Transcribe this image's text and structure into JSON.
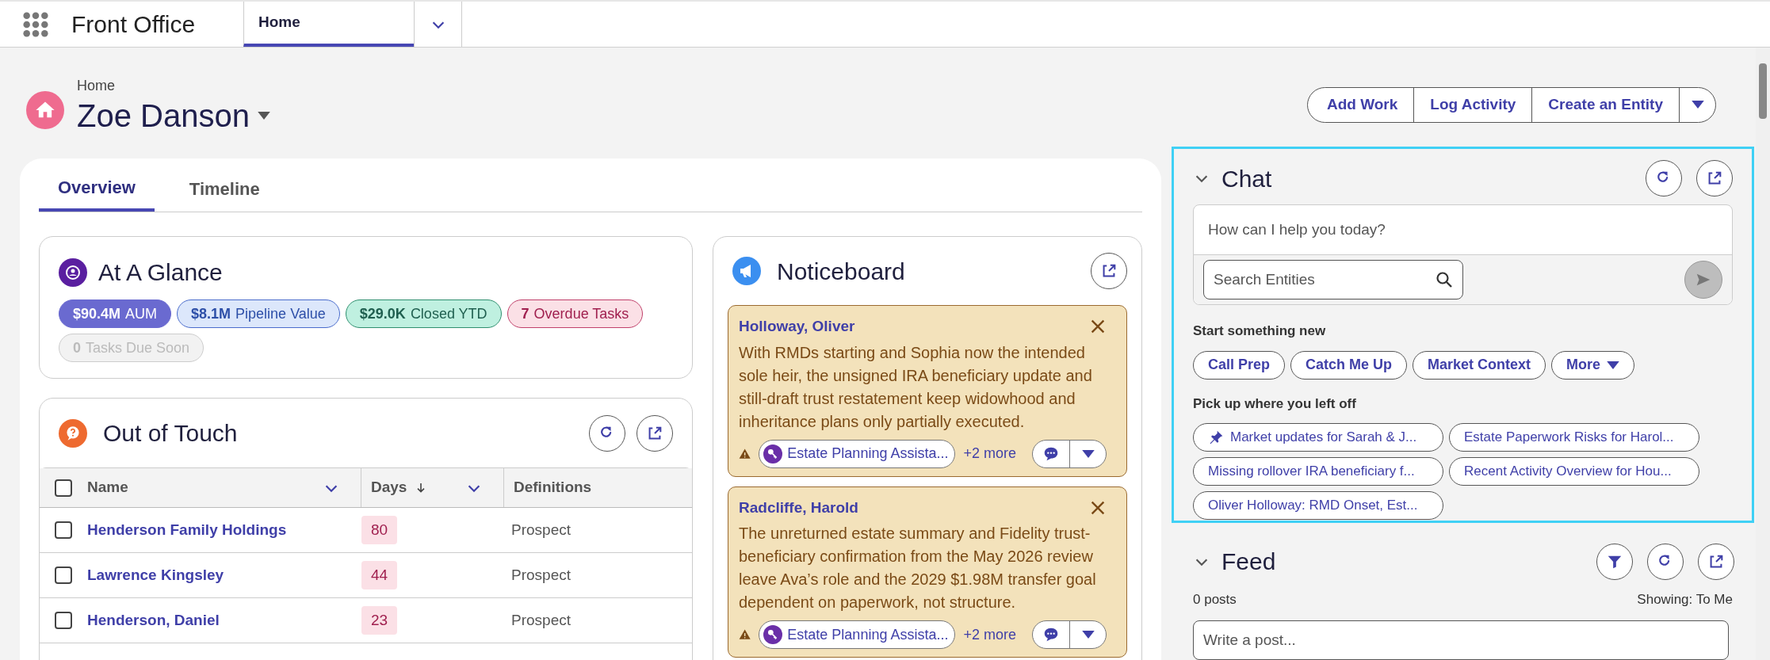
{
  "app": {
    "name": "Front Office"
  },
  "nav_tabs": [
    {
      "label": "Home",
      "selected": true
    }
  ],
  "page": {
    "breadcrumb": "Home",
    "title": "Zoe Danson"
  },
  "actions": [
    "Add Work",
    "Log Activity",
    "Create an Entity"
  ],
  "main_tabs": [
    {
      "label": "Overview",
      "selected": true
    },
    {
      "label": "Timeline",
      "selected": false
    }
  ],
  "at_a_glance": {
    "title": "At A Glance",
    "metrics": [
      {
        "kind": "aum",
        "value": "$90.4M",
        "label": "AUM"
      },
      {
        "kind": "pipeline",
        "value": "$8.1M",
        "label": "Pipeline Value"
      },
      {
        "kind": "closed",
        "value": "$29.0K",
        "label": "Closed YTD"
      },
      {
        "kind": "overdue",
        "value": "7",
        "label": "Overdue Tasks"
      },
      {
        "kind": "due",
        "value": "0",
        "label": "Tasks Due Soon"
      }
    ]
  },
  "out_of_touch": {
    "title": "Out of Touch",
    "header_checked": false,
    "columns": [
      "Name",
      "Days",
      "Definitions"
    ],
    "rows": [
      {
        "checked": false,
        "name": "Henderson Family Holdings",
        "days": "80",
        "definition": "Prospect"
      },
      {
        "checked": false,
        "name": "Lawrence Kingsley",
        "days": "44",
        "definition": "Prospect"
      },
      {
        "checked": false,
        "name": "Henderson, Daniel",
        "days": "23",
        "definition": "Prospect"
      }
    ]
  },
  "noticeboard": {
    "title": "Noticeboard",
    "notes": [
      {
        "name": "Holloway, Oliver",
        "text": "With RMDs starting and Sophia now the intended sole heir, the unsigned IRA beneficiary update and still-draft trust restatement keep widowhood and inheritance plans only partially executed.",
        "tag": "Estate Planning Assista...",
        "more": "+2 more"
      },
      {
        "name": "Radcliffe, Harold",
        "text": "The unreturned estate summary and Fidelity trust-beneficiary confirmation from the May 2026 review leave Ava’s role and the 2029 $1.98M transfer goal dependent on paperwork, not structure.",
        "tag": "Estate Planning Assista...",
        "more": "+2 more"
      }
    ]
  },
  "chat": {
    "title": "Chat",
    "expanded": true,
    "prompt_placeholder": "How can I help you today?",
    "search_placeholder": "Search Entities",
    "start_label": "Start something new",
    "starters": [
      "Call Prep",
      "Catch Me Up",
      "Market Context",
      "More"
    ],
    "recent_label": "Pick up where you left off",
    "recent": [
      {
        "label": "Market updates for Sarah & J...",
        "pinned": true
      },
      {
        "label": "Estate Paperwork Risks for Harol...",
        "pinned": false
      },
      {
        "label": "Missing rollover IRA beneficiary f...",
        "pinned": false
      },
      {
        "label": "Recent Activity Overview for Hou...",
        "pinned": false
      },
      {
        "label": "Oliver Holloway: RMD Onset, Est...",
        "pinned": false
      }
    ]
  },
  "feed": {
    "title": "Feed",
    "expanded": true,
    "count": "0 posts",
    "showing": "Showing: To Me",
    "placeholder": "Write a post..."
  }
}
